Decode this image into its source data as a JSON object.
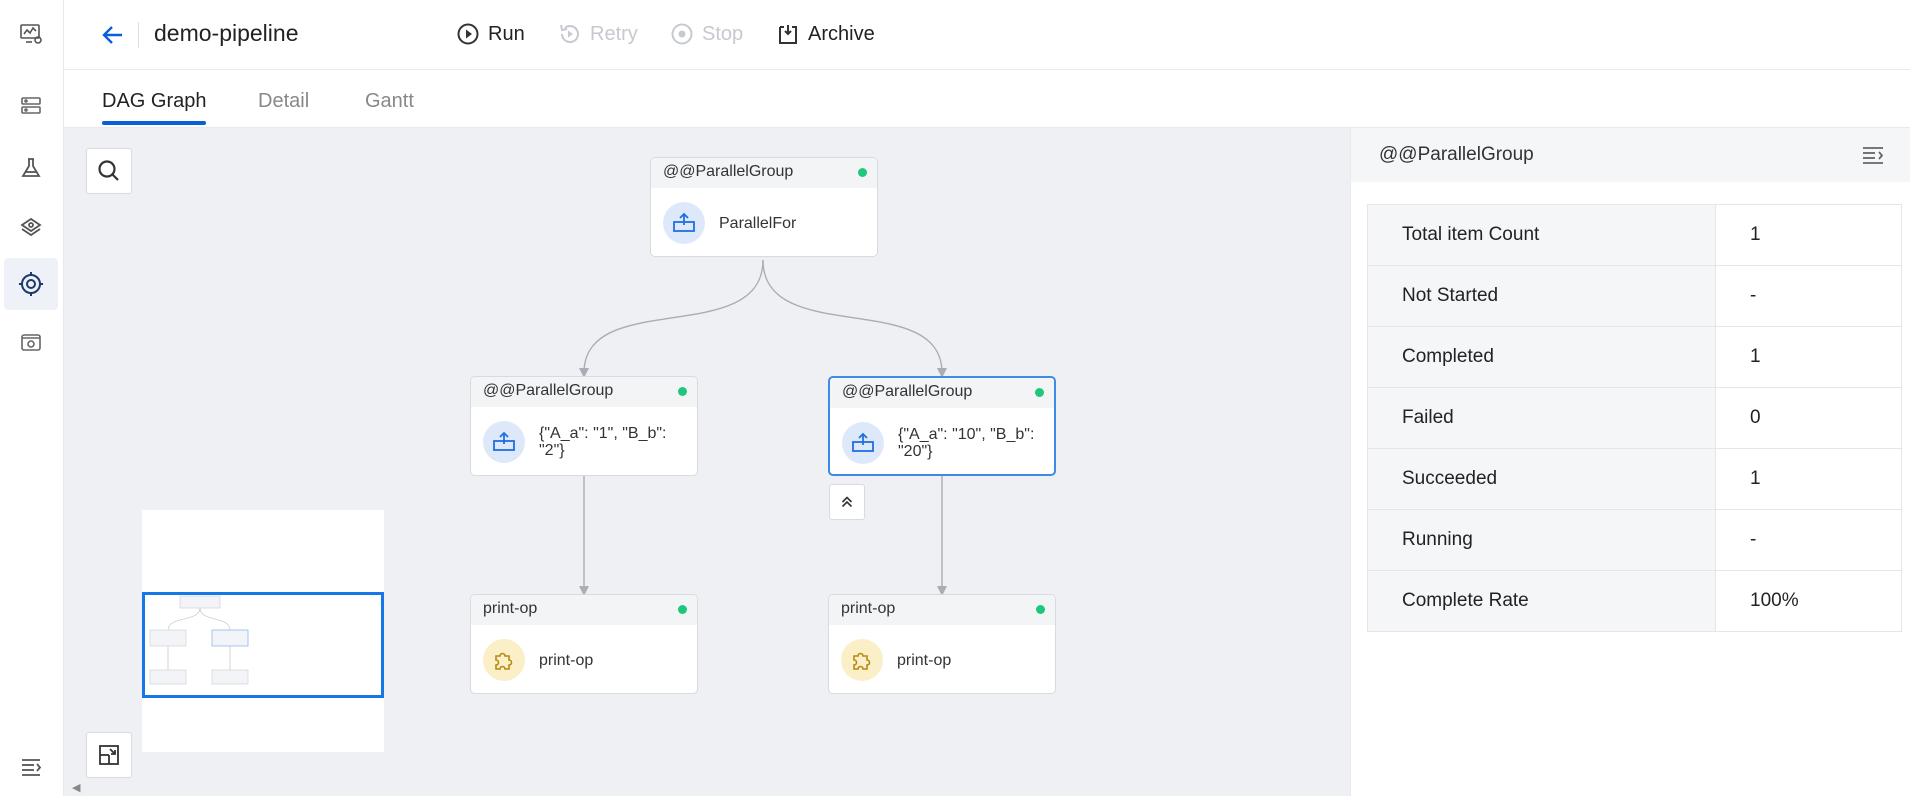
{
  "header": {
    "title": "demo-pipeline",
    "actions": {
      "run": "Run",
      "retry": "Retry",
      "stop": "Stop",
      "archive": "Archive"
    }
  },
  "tabs": [
    {
      "label": "DAG Graph",
      "active": true
    },
    {
      "label": "Detail",
      "active": false
    },
    {
      "label": "Gantt",
      "active": false
    }
  ],
  "nodes": {
    "root": {
      "title": "@@ParallelGroup",
      "label": "ParallelFor",
      "status": "succeeded"
    },
    "left_group": {
      "title": "@@ParallelGroup",
      "label": "{\"A_a\": \"1\", \"B_b\": \"2\"}",
      "status": "succeeded"
    },
    "right_group": {
      "title": "@@ParallelGroup",
      "label": "{\"A_a\": \"10\", \"B_b\": \"20\"}",
      "status": "succeeded"
    },
    "left_print": {
      "title": "print-op",
      "label": "print-op",
      "status": "succeeded"
    },
    "right_print": {
      "title": "print-op",
      "label": "print-op",
      "status": "succeeded"
    }
  },
  "panel": {
    "title": "@@ParallelGroup",
    "rows": [
      {
        "key": "Total item Count",
        "value": "1"
      },
      {
        "key": "Not Started",
        "value": "-"
      },
      {
        "key": "Completed",
        "value": "1"
      },
      {
        "key": "Failed",
        "value": "0"
      },
      {
        "key": "Succeeded",
        "value": "1"
      },
      {
        "key": "Running",
        "value": "-"
      },
      {
        "key": "Complete Rate",
        "value": "100%"
      }
    ]
  },
  "colors": {
    "accent": "#0a5ed7",
    "status_green": "#1ec77b",
    "selected_border": "#3c8ce7"
  }
}
